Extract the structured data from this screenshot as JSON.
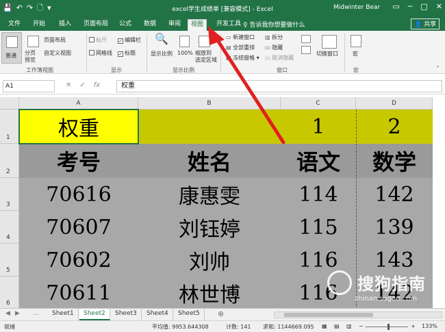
{
  "titlebar": {
    "title": "excel学生成绩单 [兼容模式] - Excel",
    "user": "Midwinter Bear",
    "qat": {
      "save": "💾",
      "undo": "↶",
      "redo": "↷",
      "new": "🗋",
      "customize": "▾"
    },
    "window_buttons": {
      "restore": "▭",
      "minimize": "─",
      "maximize": "□",
      "close": "✕"
    }
  },
  "tabs": [
    {
      "label": "文件"
    },
    {
      "label": "开始"
    },
    {
      "label": "插入"
    },
    {
      "label": "页面布局"
    },
    {
      "label": "公式"
    },
    {
      "label": "数据"
    },
    {
      "label": "审阅"
    },
    {
      "label": "视图"
    },
    {
      "label": "开发工具"
    }
  ],
  "active_tab": "视图",
  "tellme": "♀ 告诉我你想要做什么",
  "share": "👤 共享",
  "ribbon": {
    "workbook_views": {
      "label": "工作簿视图",
      "normal": "普通",
      "page_break": "分页\n预览",
      "page_layout": "页面布局",
      "custom_views": "自定义视图"
    },
    "show": {
      "label": "显示",
      "ruler": "标尺",
      "formula_bar": "编辑栏",
      "gridlines": "网格线",
      "headings": "标题"
    },
    "zoom": {
      "label": "显示比例",
      "zoom": "显示比例",
      "hundred": "100%",
      "zoom_selection": "缩放到\n选定区域"
    },
    "window": {
      "label": "窗口",
      "new_window": "新建窗口",
      "arrange_all": "全部重排",
      "freeze_panes": "冻结窗格",
      "split": "拆分",
      "hide": "隐藏",
      "unhide": "取消隐藏",
      "switch_windows": "切换窗口"
    },
    "macros": {
      "label": "宏",
      "macros": "宏"
    }
  },
  "formula_bar": {
    "name_box": "A1",
    "content": "权重"
  },
  "columns": [
    "A",
    "B",
    "C",
    "D"
  ],
  "rows": [
    {
      "num": "1",
      "cells": [
        "权重",
        "",
        "1",
        "2"
      ]
    },
    {
      "num": "2",
      "cells": [
        "考号",
        "姓名",
        "语文",
        "数学"
      ]
    },
    {
      "num": "3",
      "cells": [
        "70616",
        "康惠雯",
        "114",
        "142"
      ]
    },
    {
      "num": "4",
      "cells": [
        "70607",
        "刘钰婷",
        "115",
        "139"
      ]
    },
    {
      "num": "5",
      "cells": [
        "70602",
        "刘帅",
        "116",
        "143"
      ]
    },
    {
      "num": "6",
      "cells": [
        "70611",
        "林世博",
        "116",
        "142"
      ]
    }
  ],
  "sheets": [
    "Sheet1",
    "Sheet2",
    "Sheet3",
    "Sheet4",
    "Sheet5"
  ],
  "active_sheet": "Sheet2",
  "statusbar": {
    "mode": "就绪",
    "average": "平均值: 9953.644308",
    "count": "计数: 141",
    "sum": "求和: 1144669.095",
    "zoom": "133%"
  },
  "watermark": {
    "text": "搜狗指南",
    "url": "zhinan.sogou.com"
  },
  "colors": {
    "excel_green": "#217346",
    "weight_row": "#c8c800",
    "header_row": "#9a9a9a",
    "data_rows": "#a8a8a8",
    "arrow_red": "#e02020"
  }
}
